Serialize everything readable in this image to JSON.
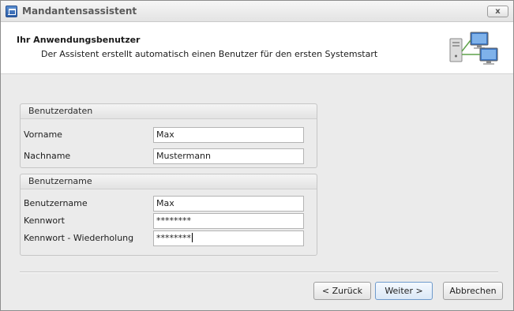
{
  "window": {
    "title": "Mandantensassistent",
    "close_label": "x"
  },
  "header": {
    "title": "Ihr Anwendungsbenutzer",
    "subtitle": "Der Assistent erstellt automatisch einen Benutzer für den ersten Systemstart",
    "icon": "network-computers-icon"
  },
  "benutzerdaten": {
    "heading": "Benutzerdaten",
    "fields": [
      {
        "label": "Vorname",
        "value": "Max"
      },
      {
        "label": "Nachname",
        "value": "Mustermann"
      }
    ]
  },
  "benutzername": {
    "heading": "Benutzername",
    "fields": [
      {
        "label": "Benutzername",
        "value": "Max"
      },
      {
        "label": "Kennwort",
        "value": "********"
      },
      {
        "label": "Kennwort - Wiederholung",
        "value": "********"
      }
    ]
  },
  "buttons": {
    "back": "< Zurück",
    "next": "Weiter >",
    "cancel": "Abbrechen"
  }
}
